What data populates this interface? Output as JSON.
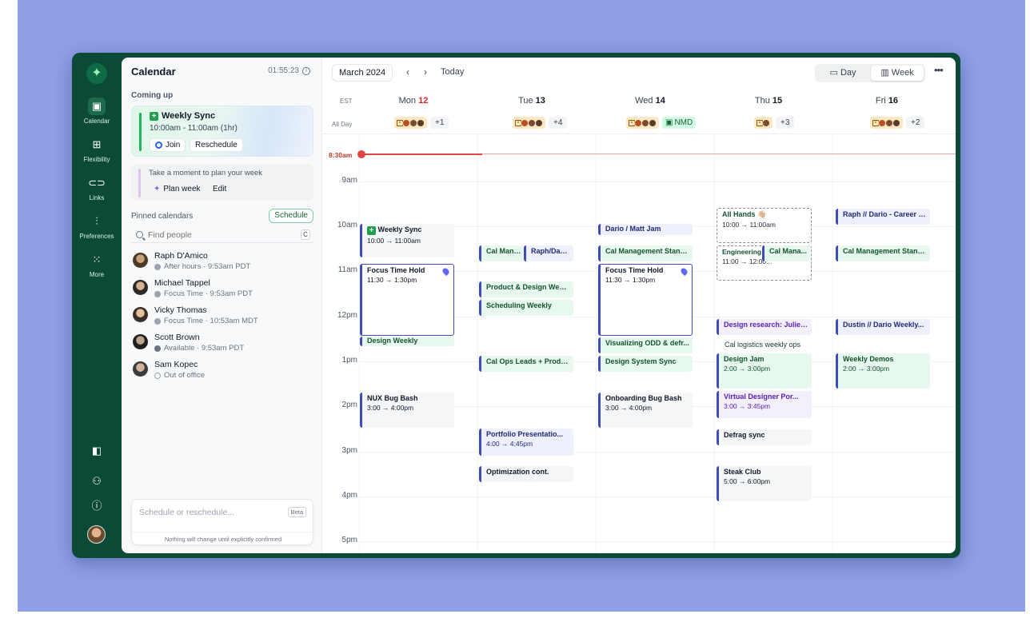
{
  "rail": {
    "items": [
      {
        "label": "Calendar",
        "icon": "calendar-icon"
      },
      {
        "label": "Flexibility",
        "icon": "flexibility-icon"
      },
      {
        "label": "Links",
        "icon": "link-icon"
      },
      {
        "label": "Preferences",
        "icon": "sliders-icon"
      },
      {
        "label": "More",
        "icon": "grid-icon"
      }
    ]
  },
  "sidebar": {
    "title": "Calendar",
    "clock": "01:55:23",
    "coming_up": "Coming up",
    "upnext": {
      "title": "Weekly Sync",
      "time": "10:00am - 11:00am (1hr)",
      "join": "Join",
      "reschedule": "Reschedule"
    },
    "plan": {
      "text": "Take a moment to plan your week",
      "plan_week": "Plan week",
      "edit": "Edit"
    },
    "pinned": "Pinned calendars",
    "schedule": "Schedule",
    "search_placeholder": "Find people",
    "search_key": "C",
    "people": [
      {
        "name": "Raph D'Amico",
        "status": "After hours · 9:53am PDT"
      },
      {
        "name": "Michael Tappel",
        "status": "Focus Time · 9:53am PDT"
      },
      {
        "name": "Vicky Thomas",
        "status": "Focus Time · 10:53am MDT"
      },
      {
        "name": "Scott Brown",
        "status": "Available · 9:53am PDT"
      },
      {
        "name": "Sam Kopec",
        "status": "Out of office"
      }
    ],
    "assist_placeholder": "Schedule or reschedule...",
    "beta": "Beta",
    "assist_note": "Nothing will change until explicitly confirmed"
  },
  "toolbar": {
    "month": "March 2024",
    "today": "Today",
    "day": "Day",
    "week": "Week",
    "more": "•••"
  },
  "calendar": {
    "timezone": "EST",
    "all_day": "All Day",
    "days": [
      {
        "dow": "Mon",
        "num": "12"
      },
      {
        "dow": "Tue",
        "num": "13"
      },
      {
        "dow": "Wed",
        "num": "14"
      },
      {
        "dow": "Thu",
        "num": "15"
      },
      {
        "dow": "Fri",
        "num": "16"
      }
    ],
    "allday_more": [
      "+1",
      "+4",
      "NMD",
      "+3",
      "+2"
    ],
    "now": "8:30am",
    "hours": [
      "9am",
      "10am",
      "11am",
      "12pm",
      "1pm",
      "2pm",
      "3pm",
      "4pm",
      "5pm"
    ],
    "events": {
      "mon_weekly": {
        "title": "Weekly Sync",
        "time": "10:00 → 11:00am"
      },
      "mon_focus": {
        "title": "Focus Time Hold",
        "time": "11:30 → 1:30pm"
      },
      "mon_design": {
        "title": "Design Weekly"
      },
      "mon_nux": {
        "title": "NUX Bug Bash",
        "time": "3:00 → 4:00pm"
      },
      "tue_cal": {
        "title": "Cal Manage"
      },
      "tue_raph": {
        "title": "Raph/Dari..."
      },
      "tue_pdw": {
        "title": "Product & Design Weekly"
      },
      "tue_sched": {
        "title": "Scheduling Weekly"
      },
      "tue_ops": {
        "title": "Cal Ops Leads + Produ..."
      },
      "tue_port": {
        "title": "Portfolio Presentatio...",
        "time": "4:00 → 4:45pm"
      },
      "tue_opt": {
        "title": "Optimization cont."
      },
      "wed_dario": {
        "title": "Dario / Matt Jam"
      },
      "wed_cal": {
        "title": "Cal Management Stand..."
      },
      "wed_focus": {
        "title": "Focus Time Hold",
        "time": "11:30 → 1:30pm"
      },
      "wed_vis": {
        "title": "Visualizing ODD & defr..."
      },
      "wed_dss": {
        "title": "Design System Sync"
      },
      "wed_onb": {
        "title": "Onboarding Bug Bash",
        "time": "3:00 → 4:00pm"
      },
      "thu_all": {
        "title": "All Hands 👋🏼",
        "time": "10:00 → 11:00am"
      },
      "thu_eng": {
        "title": "Engineering",
        "time": "11:00 → 12:00..."
      },
      "thu_cal": {
        "title": "Cal Mana..."
      },
      "thu_res": {
        "title": "Design research: Juliett..."
      },
      "thu_log": {
        "title": "Cal logistics weekly ops"
      },
      "thu_jam": {
        "title": "Design Jam",
        "time": "2:00 → 3:00pm"
      },
      "thu_vir": {
        "title": "Virtual Designer Por...",
        "time": "3:00 → 3:45pm"
      },
      "thu_defrag": {
        "title": "Defrag sync"
      },
      "thu_steak": {
        "title": "Steak Club",
        "time": "5:00 → 6:00pm"
      },
      "fri_raph": {
        "title": "Raph // Dario - Career g..."
      },
      "fri_cal": {
        "title": "Cal Management Stand..."
      },
      "fri_dustin": {
        "title": "Dustin // Dario Weekly..."
      },
      "fri_demos": {
        "title": "Weekly Demos",
        "time": "2:00 → 3:00pm"
      }
    }
  },
  "colors": {
    "brand": "#0b4a36",
    "accent": "#3f4cb8",
    "now": "#e04646",
    "backdrop": "#8f9fe8"
  }
}
